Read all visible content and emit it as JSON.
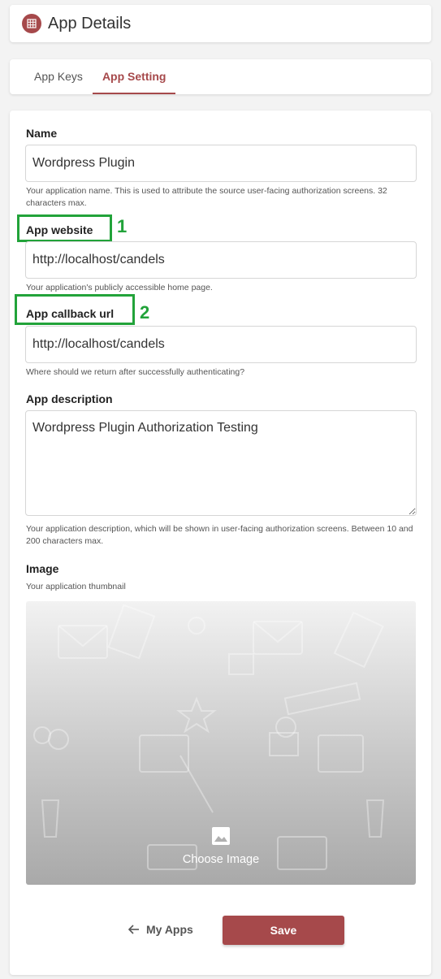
{
  "header": {
    "title": "App Details",
    "icon": "app-grid-icon"
  },
  "tabs": [
    {
      "label": "App Keys",
      "active": false
    },
    {
      "label": "App Setting",
      "active": true
    }
  ],
  "form": {
    "name": {
      "label": "Name",
      "value": "Wordpress Plugin",
      "help": "Your application name. This is used to attribute the source user-facing authorization screens. 32 characters max."
    },
    "website": {
      "label": "App website",
      "value": "http://localhost/candels",
      "help": "Your application's publicly accessible home page.",
      "annotation": "1"
    },
    "callback": {
      "label": "App callback url",
      "value": "http://localhost/candels",
      "help": "Where should we return after successfully authenticating?",
      "annotation": "2"
    },
    "description": {
      "label": "App description",
      "value": "Wordpress Plugin Authorization Testing",
      "help": "Your application description, which will be shown in user-facing authorization screens. Between 10 and 200 characters max."
    },
    "image": {
      "label": "Image",
      "help": "Your application thumbnail",
      "choose_label": "Choose Image"
    }
  },
  "actions": {
    "back_label": "My Apps",
    "save_label": "Save"
  },
  "colors": {
    "accent": "#a6494b",
    "annotation": "#22a33a"
  }
}
